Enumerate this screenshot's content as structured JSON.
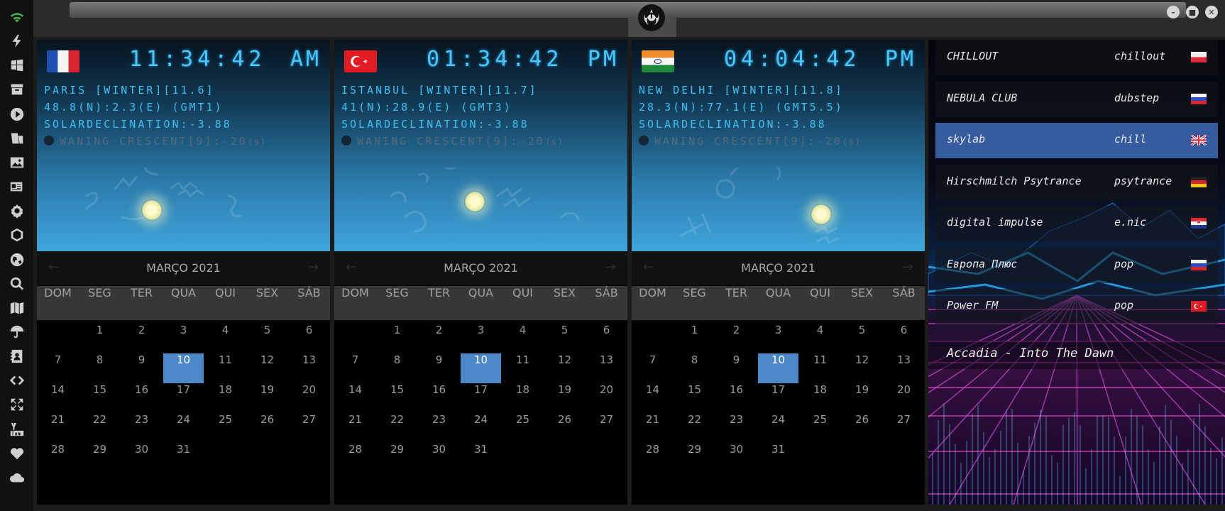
{
  "sidebar": {
    "icons": [
      "wifi-icon",
      "bolt-icon",
      "windows-icon",
      "archive-icon",
      "play-icon",
      "translate-icon",
      "image-icon",
      "newspaper-icon",
      "gear-icon",
      "hexagon-icon",
      "globe-icon",
      "search-icon",
      "map-icon",
      "umbrella-icon",
      "contact-icon",
      "code-icon",
      "expand-icon",
      "youtube-icon",
      "heart-icon",
      "cloud-icon"
    ],
    "accent": "#4caf50"
  },
  "window": {
    "controls": [
      "minimize",
      "maximize",
      "close"
    ],
    "emblem_icon": "rebel-alliance-icon"
  },
  "cities": [
    {
      "flag": "france",
      "time": "11:34:42",
      "ampm": "AM",
      "location": "PARIS [WINTER][11.6]",
      "coords": "48.8(N):2.3(E) (GMT1)",
      "declination": "SOLARDECLINATION:-3.88",
      "moon": "WANING CRESCENT[9]:-20",
      "moon_unit": "(s)",
      "calendar": {
        "title": "MARÇO 2021",
        "weekdays": [
          "DOM",
          "SEG",
          "TER",
          "QUA",
          "QUI",
          "SEX",
          "SÁB"
        ],
        "days": [
          "",
          "1",
          "2",
          "3",
          "4",
          "5",
          "6",
          "7",
          "8",
          "9",
          "10",
          "11",
          "12",
          "13",
          "14",
          "15",
          "16",
          "17",
          "18",
          "19",
          "20",
          "21",
          "22",
          "23",
          "24",
          "25",
          "26",
          "27",
          "28",
          "29",
          "30",
          "31"
        ],
        "today": "10"
      }
    },
    {
      "flag": "turkey",
      "time": "01:34:42",
      "ampm": "PM",
      "location": "ISTANBUL [WINTER][11.7]",
      "coords": "41(N):28.9(E) (GMT3)",
      "declination": "SOLARDECLINATION:-3.88",
      "moon": "WANING CRESCENT[9]:-20",
      "moon_unit": "(s)",
      "calendar": {
        "title": "MARÇO 2021",
        "weekdays": [
          "DOM",
          "SEG",
          "TER",
          "QUA",
          "QUI",
          "SEX",
          "SÁB"
        ],
        "days": [
          "",
          "1",
          "2",
          "3",
          "4",
          "5",
          "6",
          "7",
          "8",
          "9",
          "10",
          "11",
          "12",
          "13",
          "14",
          "15",
          "16",
          "17",
          "18",
          "19",
          "20",
          "21",
          "22",
          "23",
          "24",
          "25",
          "26",
          "27",
          "28",
          "29",
          "30",
          "31"
        ],
        "today": "10"
      }
    },
    {
      "flag": "india",
      "time": "04:04:42",
      "ampm": "PM",
      "location": "NEW DELHI [WINTER][11.8]",
      "coords": "28.3(N):77.1(E) (GMT5.5)",
      "declination": "SOLARDECLINATION:-3.88",
      "moon": "WANING CRESCENT[9]:-20",
      "moon_unit": "(s)",
      "calendar": {
        "title": "MARÇO 2021",
        "weekdays": [
          "DOM",
          "SEG",
          "TER",
          "QUA",
          "QUI",
          "SEX",
          "SÁB"
        ],
        "days": [
          "",
          "1",
          "2",
          "3",
          "4",
          "5",
          "6",
          "7",
          "8",
          "9",
          "10",
          "11",
          "12",
          "13",
          "14",
          "15",
          "16",
          "17",
          "18",
          "19",
          "20",
          "21",
          "22",
          "23",
          "24",
          "25",
          "26",
          "27",
          "28",
          "29",
          "30",
          "31"
        ],
        "today": "10"
      }
    }
  ],
  "radio": {
    "stations": [
      {
        "name": "CHILLOUT",
        "genre": "chillout",
        "flag": "poland",
        "active": false
      },
      {
        "name": "NEBULA CLUB",
        "genre": "dubstep",
        "flag": "russia",
        "active": false
      },
      {
        "name": "skylab",
        "genre": "chill",
        "flag": "uk",
        "active": true
      },
      {
        "name": "Hirschmilch Psytrance",
        "genre": "psytrance",
        "flag": "germany",
        "active": false
      },
      {
        "name": "digital impulse",
        "genre": "e.nic",
        "flag": "croatia",
        "active": false
      },
      {
        "name": "Европа Плюс",
        "genre": "pop",
        "flag": "russia",
        "active": false
      },
      {
        "name": "Power FM",
        "genre": "pop",
        "flag": "turkey",
        "active": false
      }
    ],
    "now_playing": "Accadia - Into The Dawn",
    "active_color": "#4678cd"
  }
}
